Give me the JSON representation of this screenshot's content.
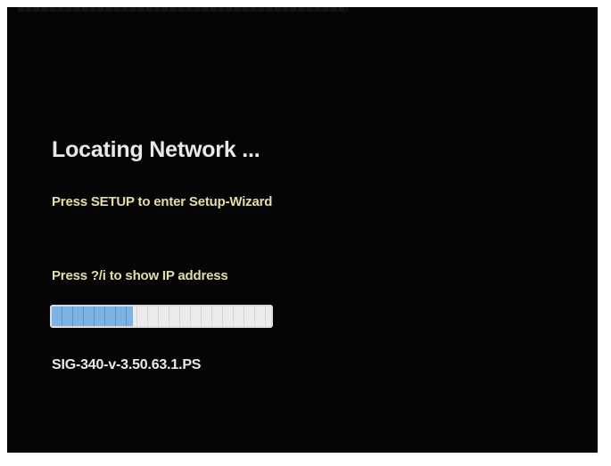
{
  "screen": {
    "title": "Locating Network ...",
    "setup_hint": "Press SETUP to enter Setup-Wizard",
    "ip_hint": "Press ?/i to show IP address",
    "progress": 0.37,
    "version": "SIG-340-v-3.50.63.1.PS"
  },
  "colors": {
    "background": "#050505",
    "title_text": "#e9e9e9",
    "hint_text": "#e4dfa0",
    "progress_fill": "#7fb3e6",
    "progress_track": "#ececec"
  }
}
